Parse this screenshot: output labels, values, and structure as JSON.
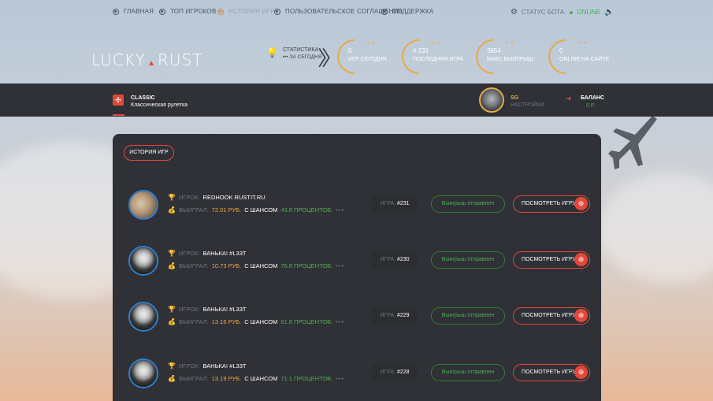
{
  "nav": {
    "items": [
      {
        "label": "ГЛАВНАЯ"
      },
      {
        "label": "ТОП ИГРОКОВ"
      },
      {
        "label": "ИСТОРИЯ ИГР"
      },
      {
        "label": "ПОЛЬЗОВАТЕЛЬСКОЕ СОГЛАШЕНИЕ"
      },
      {
        "label": "ПОДДЕРЖКА"
      }
    ],
    "active": "ИСТОРИЯ ИГР",
    "bot_status_label": "СТАТУС БОТА:",
    "bot_status_value": "ONLINE"
  },
  "logo": {
    "left": "LUCKY",
    "right": "RUST"
  },
  "stats_header": {
    "title": "СТАТИСТИКА",
    "subtitle": "ЗА СЕГОДНЯ"
  },
  "stats": [
    {
      "value": "0",
      "label": "ИГР СЕГОДНЯ"
    },
    {
      "value": "# 231",
      "label": "ПОСЛЕДНЯЯ ИГРА"
    },
    {
      "value": "3654",
      "label": "МАКС.ВЫИГРЫШ"
    },
    {
      "value": "0",
      "label": "ONLINE НА САЙТЕ"
    }
  ],
  "mode": {
    "title": "CLASSIC",
    "subtitle": "Классическая рулетка"
  },
  "user": {
    "name": "SG",
    "settings": "НАСТРОЙКИ"
  },
  "balance": {
    "label": "БАЛАНС",
    "value": "0 Р"
  },
  "history_button": "ИСТОРИЯ ИГР",
  "row_labels": {
    "player": "ИГРОК:",
    "won": "ВЫИГРАЛ:",
    "with_chance": "С ШАНСОМ",
    "game": "ИГРА:",
    "sent": "Выигрыш отправлен",
    "view": "ПОСМОТРЕТЬ ИГРУ"
  },
  "games": [
    {
      "player": "REDHOOK RUSTIT.RU",
      "amount": "72.01 РУБ.",
      "chance": "43.8 ПРОЦЕНТОВ.",
      "game": "#231"
    },
    {
      "player": "ВАНЬКА! #L33T",
      "amount": "10.73 РУБ.",
      "chance": "75.8 ПРОЦЕНТОВ.",
      "game": "#230"
    },
    {
      "player": "ВАНЬКА! #L33T",
      "amount": "13.16 РУБ.",
      "chance": "61.8 ПРОЦЕНТОВ.",
      "game": "#229"
    },
    {
      "player": "ВАНЬКА! #L33T",
      "amount": "13.19 РУБ.",
      "chance": "71.1 ПРОЦЕНТОВ.",
      "game": "#228"
    }
  ],
  "colors": {
    "accent": "#e2483a",
    "gold": "#e7a94a",
    "green": "#4caf50",
    "panel": "#2f3136"
  }
}
